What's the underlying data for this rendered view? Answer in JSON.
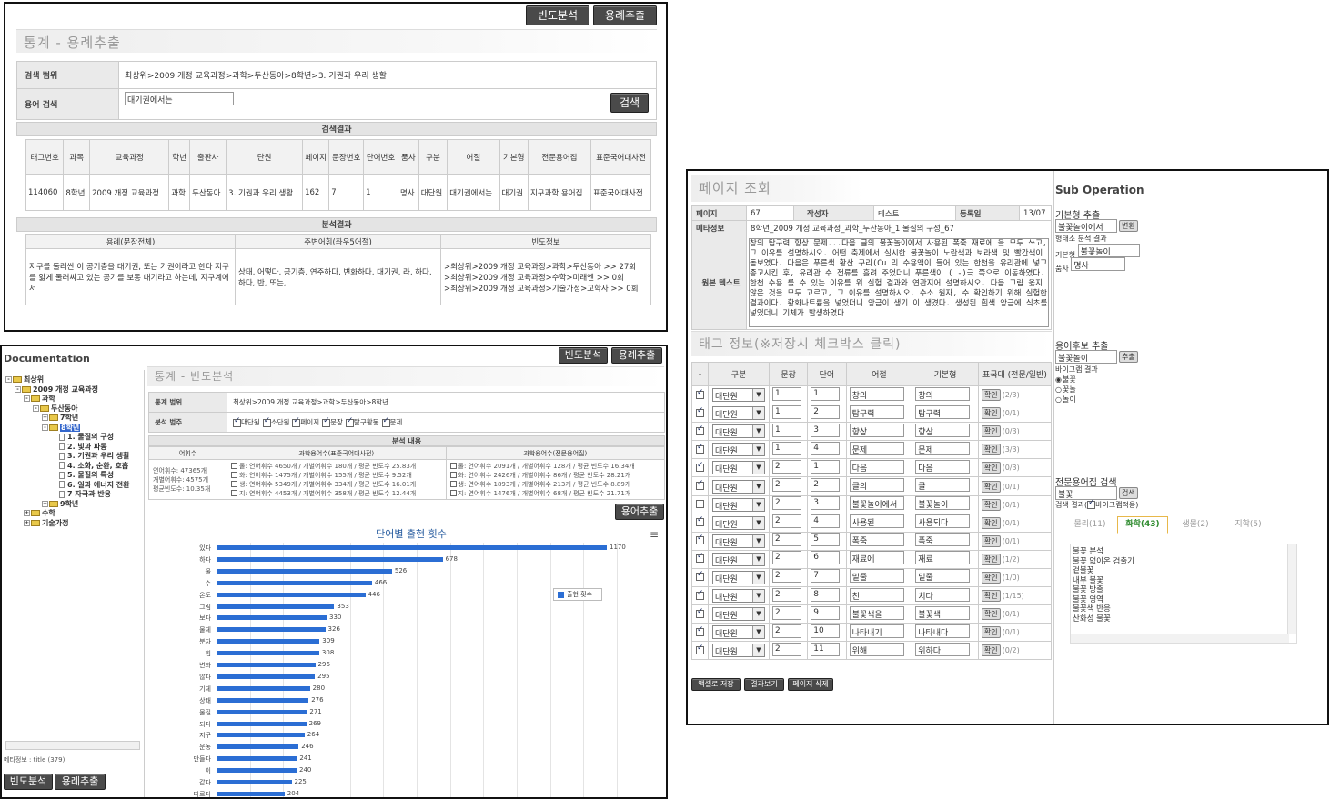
{
  "p1": {
    "btn_freq": "빈도분석",
    "btn_ex": "용례추출",
    "title": "통계 - 용례추출",
    "range_label": "검색 범위",
    "range_value": "최상위>2009 개정 교육과정>과학>두산동아>8학년>3. 기권과 우리 생활",
    "term_label": "용어 검색",
    "term_value": "대기권에서는",
    "search_btn": "검색",
    "result_header": "검색결과",
    "cols": [
      "태그번호",
      "과목",
      "교육과정",
      "학년",
      "출판사",
      "단원",
      "페이지",
      "문장번호",
      "단어번호",
      "품사",
      "구분",
      "어절",
      "기본형",
      "전문용어집",
      "표준국어대사전"
    ],
    "row": [
      "114060",
      "8학년",
      "2009 개정 교육과정",
      "과학",
      "두산동아",
      "3. 기권과 우리 생활",
      "162",
      "7",
      "1",
      "명사",
      "대단원",
      "대기권에서는",
      "대기권",
      "지구과학 용어집",
      "표준국어대사전"
    ],
    "analysis_header": "분석결과",
    "a_cols": [
      "용례(문장전체)",
      "주변어휘(좌우5어절)",
      "빈도정보"
    ],
    "a_sentence": "지구를 둘러싼 이 공기층을 대기권, 또는 기권이라고 한다 지구를 얇게 둘러싸고 있는 공기를 보통 대기라고 하는데, 지구계에서",
    "a_around": "상태, 어떻다, 공기층, 연주하다, 변화하다, 대기권, 라, 하다, 하다, 반, 또는,",
    "a_freq": [
      ">최상위>2009 개정 교육과정>과학>두산동아 >> 27회",
      ">최상위>2009 개정 교육과정>수학>미래엔 >> 0회",
      ">최상위>2009 개정 교육과정>기술가정>교학사 >> 0회"
    ]
  },
  "p2": {
    "doc_title": "Documentation",
    "tree": [
      {
        "d": 0,
        "t": "최상위",
        "k": "f",
        "pm": "-"
      },
      {
        "d": 1,
        "t": "2009 개정 교육과정",
        "k": "f",
        "pm": "-"
      },
      {
        "d": 2,
        "t": "과학",
        "k": "f",
        "pm": "-"
      },
      {
        "d": 3,
        "t": "두산동아",
        "k": "f",
        "pm": "-"
      },
      {
        "d": 4,
        "t": "7학년",
        "k": "f",
        "pm": "+"
      },
      {
        "d": 4,
        "t": "8학년",
        "k": "f",
        "pm": "-",
        "sel": true
      },
      {
        "d": 5,
        "t": "1. 물질의 구성",
        "k": "d"
      },
      {
        "d": 5,
        "t": "2. 빛과 파동",
        "k": "d"
      },
      {
        "d": 5,
        "t": "3. 기권과 우리 생활",
        "k": "d"
      },
      {
        "d": 5,
        "t": "4. 소화, 순환, 호흡",
        "k": "d"
      },
      {
        "d": 5,
        "t": "5. 물질의 특성",
        "k": "d"
      },
      {
        "d": 5,
        "t": "6. 일과 에너지 전환",
        "k": "d"
      },
      {
        "d": 5,
        "t": "7 자극과 반응",
        "k": "d"
      },
      {
        "d": 4,
        "t": "9학년",
        "k": "f",
        "pm": "+"
      },
      {
        "d": 2,
        "t": "수학",
        "k": "f",
        "pm": "+"
      },
      {
        "d": 2,
        "t": "기술가정",
        "k": "f",
        "pm": "+"
      }
    ],
    "meta": "메타정보 : title (379)",
    "btn_freq": "빈도분석",
    "btn_ex": "용례추출",
    "title": "통계 - 빈도분석",
    "range_label": "통계 범위",
    "range_value": "최상위>2009 개정 교육과정>과학>두산동아>8학년",
    "cat_label": "분석 범주",
    "cats": [
      "대단원",
      "소단원",
      "페이지",
      "문장",
      "탐구활동",
      "문제"
    ],
    "content_header": "분석 내용",
    "c_cols": [
      "어휘수",
      "과학용어수(표준국어대사전)",
      "과학용어수(전문용어집)"
    ],
    "c1": [
      "연어휘수: 47365개",
      "개별어휘수: 4575개",
      "평균빈도수: 10.35개"
    ],
    "c2": [
      "물: 연어휘수 4650개 / 개별어휘수 180개 / 평균 빈도수 25.83개",
      "화: 연어휘수 1475개 / 개별어휘수 155개 / 평균 빈도수 9.52개",
      "생: 연어휘수 5349개 / 개별어휘수 334개 / 평균 빈도수 16.01개",
      "지: 연어휘수 4453개 / 개별어휘수 358개 / 평균 빈도수 12.44개"
    ],
    "c3": [
      "물: 연어휘수 2091개 / 개별어휘수 128개 / 평균 빈도수 16.34개",
      "화: 연어휘수 2426개 / 개별어휘수 86개 / 평균 빈도수 28.21개",
      "생: 연어휘수 1893개 / 개별어휘수 213개 / 평균 빈도수 8.89개",
      "지: 연어휘수 1476개 / 개별어휘수 68개 / 평균 빈도수 21.71개"
    ],
    "btn_ex2": "용어추출"
  },
  "chart_data": {
    "type": "bar",
    "orientation": "horizontal",
    "title": "단어별 출현 횟수",
    "legend": "출현 횟수",
    "legend_position": "right",
    "xlim": [
      0,
      1200
    ],
    "categories": [
      "있다",
      "하다",
      "물",
      "수",
      "온도",
      "그림",
      "보다",
      "물체",
      "분자",
      "힘",
      "변화",
      "않다",
      "기체",
      "상태",
      "물질",
      "되다",
      "지구",
      "운동",
      "만들다",
      "이",
      "같다",
      "따르다"
    ],
    "values": [
      1170,
      678,
      526,
      466,
      446,
      353,
      330,
      326,
      309,
      308,
      296,
      295,
      280,
      276,
      271,
      269,
      264,
      246,
      241,
      240,
      225,
      204
    ],
    "color": "#2b6ed4"
  },
  "p3": {
    "title": "페이지 조회",
    "page_label": "페이지",
    "page_val": "67",
    "author_label": "작성자",
    "author_val": "테스트",
    "reg_label": "등록일",
    "reg_val": "13/07",
    "meta_label": "메타정보",
    "meta_val": "8학년_2009 개정 교육과정_과학_두산동아_1 물질의 구성_67",
    "orig_label": "원본 텍스트",
    "orig_text": "창의 탐구력 향상 문제...다음 글의 불꽃놀이에서 사용된 폭죽 재료에 을 모두 쓰고, 그 이유를 설명하시오. 어떤 축제에서 실시한 불꽃놀이 노란색과 보라색 및 빨간색이 돋보였다. 다음은 푸른색 황산 구리(Cu 리 수용액이 들어 있는 한천을 유리관에 넣고 종고시킨 후, 유리관 수 전류를 흘려 주었더니 푸른색이 ( -)극 쪽으로 이동하였다. 한천 수용 를 수 있는 이유를 위 실험 결과와 연관지어 설명하시오. 다음 그림 옳지 않은 것을 모두 고르고, 그 이유를 설명하시오. 수소 원자, 수 확인하기 위해 실험한 결과이다. 황화나트륨을 넣었더니 앙금이 생기 이 생겼다. 생성된 흰색 앙금에 식초를 넣었더니 기체가 발생하였다",
    "tag_title": "태그 정보(※저장시 체크박스 클릭)",
    "t_cols": [
      "-",
      "구분",
      "문장",
      "단어",
      "어절",
      "기본형",
      "표국대 (전문/일반)"
    ],
    "rows": [
      {
        "c": true,
        "g": "대단원",
        "s": "1",
        "w": "1",
        "e": "창의",
        "b": "창의",
        "k": "(2/3)"
      },
      {
        "c": true,
        "g": "대단원",
        "s": "1",
        "w": "2",
        "e": "탐구력",
        "b": "탐구력",
        "k": "(0/1)"
      },
      {
        "c": true,
        "g": "대단원",
        "s": "1",
        "w": "3",
        "e": "향상",
        "b": "향상",
        "k": "(0/3)"
      },
      {
        "c": true,
        "g": "대단원",
        "s": "1",
        "w": "4",
        "e": "문제",
        "b": "문제",
        "k": "(3/3)"
      },
      {
        "c": true,
        "g": "대단원",
        "s": "2",
        "w": "1",
        "e": "다음",
        "b": "다음",
        "k": "(0/3)"
      },
      {
        "c": true,
        "g": "대단원",
        "s": "2",
        "w": "2",
        "e": "글의",
        "b": "글",
        "k": "(0/1)"
      },
      {
        "c": false,
        "g": "대단원",
        "s": "2",
        "w": "3",
        "e": "불꽃놀이에서",
        "b": "불꽃놀이",
        "k": "(0/1)"
      },
      {
        "c": true,
        "g": "대단원",
        "s": "2",
        "w": "4",
        "e": "사용된",
        "b": "사용되다",
        "k": "(0/1)"
      },
      {
        "c": true,
        "g": "대단원",
        "s": "2",
        "w": "5",
        "e": "폭죽",
        "b": "폭죽",
        "k": "(0/1)"
      },
      {
        "c": true,
        "g": "대단원",
        "s": "2",
        "w": "6",
        "e": "재료에",
        "b": "재료",
        "k": "(1/2)"
      },
      {
        "c": true,
        "g": "대단원",
        "s": "2",
        "w": "7",
        "e": "밑줄",
        "b": "밑줄",
        "k": "(1/0)"
      },
      {
        "c": true,
        "g": "대단원",
        "s": "2",
        "w": "8",
        "e": "친",
        "b": "치다",
        "k": "(1/15)"
      },
      {
        "c": true,
        "g": "대단원",
        "s": "2",
        "w": "9",
        "e": "불꽃색을",
        "b": "불꽃색",
        "k": "(0/1)"
      },
      {
        "c": true,
        "g": "대단원",
        "s": "2",
        "w": "10",
        "e": "나타내기",
        "b": "나타내다",
        "k": "(0/1)"
      },
      {
        "c": true,
        "g": "대단원",
        "s": "2",
        "w": "11",
        "e": "위해",
        "b": "위하다",
        "k": "(0/2)"
      }
    ],
    "confirm": "확인",
    "btn_save": "액셀로 저장",
    "btn_view": "결과보기",
    "btn_del": "페이지 삭제",
    "sub_title": "Sub Operation",
    "base_title": "기본형 추출",
    "base_input": "불꽃놀이에서",
    "base_btn": "변환",
    "morph": "형태소 분석 결과",
    "base_lbl": "기본형",
    "base_res": "불꽃놀이",
    "pos_lbl": "품사",
    "pos_res": "명사",
    "cand_title": "용어후보 추출",
    "cand_input": "불꽃놀이",
    "cand_btn": "추출",
    "bigram": "바이그램 결과",
    "bigram_opts": [
      "불꽃",
      "꽃놀",
      "놀이"
    ],
    "term_title": "전문용어집 검색",
    "term_input": "불꽃",
    "term_btn": "검색",
    "term_result": "검색 결과(",
    "bigram_apply": "바이그램적용)",
    "tabs": [
      "물리(11)",
      "화학(43)",
      "생물(2)",
      "지학(5)"
    ],
    "list": [
      "불꽃 분석",
      "불꽃 없이온 검출기",
      "겉불꽃",
      "내부 불꽃",
      "불꽃 방출",
      "불꽃 영역",
      "불꽃색 반응",
      "산화성 불꽃"
    ]
  }
}
